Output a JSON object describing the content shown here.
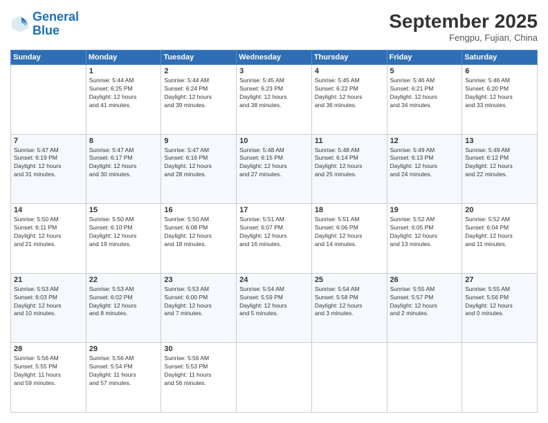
{
  "header": {
    "logo_line1": "General",
    "logo_line2": "Blue",
    "month_title": "September 2025",
    "location": "Fengpu, Fujian, China"
  },
  "weekdays": [
    "Sunday",
    "Monday",
    "Tuesday",
    "Wednesday",
    "Thursday",
    "Friday",
    "Saturday"
  ],
  "weeks": [
    [
      {
        "day": "",
        "info": ""
      },
      {
        "day": "1",
        "info": "Sunrise: 5:44 AM\nSunset: 6:25 PM\nDaylight: 12 hours\nand 41 minutes."
      },
      {
        "day": "2",
        "info": "Sunrise: 5:44 AM\nSunset: 6:24 PM\nDaylight: 12 hours\nand 39 minutes."
      },
      {
        "day": "3",
        "info": "Sunrise: 5:45 AM\nSunset: 6:23 PM\nDaylight: 12 hours\nand 38 minutes."
      },
      {
        "day": "4",
        "info": "Sunrise: 5:45 AM\nSunset: 6:22 PM\nDaylight: 12 hours\nand 36 minutes."
      },
      {
        "day": "5",
        "info": "Sunrise: 5:46 AM\nSunset: 6:21 PM\nDaylight: 12 hours\nand 34 minutes."
      },
      {
        "day": "6",
        "info": "Sunrise: 5:46 AM\nSunset: 6:20 PM\nDaylight: 12 hours\nand 33 minutes."
      }
    ],
    [
      {
        "day": "7",
        "info": "Sunrise: 5:47 AM\nSunset: 6:19 PM\nDaylight: 12 hours\nand 31 minutes."
      },
      {
        "day": "8",
        "info": "Sunrise: 5:47 AM\nSunset: 6:17 PM\nDaylight: 12 hours\nand 30 minutes."
      },
      {
        "day": "9",
        "info": "Sunrise: 5:47 AM\nSunset: 6:16 PM\nDaylight: 12 hours\nand 28 minutes."
      },
      {
        "day": "10",
        "info": "Sunrise: 5:48 AM\nSunset: 6:15 PM\nDaylight: 12 hours\nand 27 minutes."
      },
      {
        "day": "11",
        "info": "Sunrise: 5:48 AM\nSunset: 6:14 PM\nDaylight: 12 hours\nand 25 minutes."
      },
      {
        "day": "12",
        "info": "Sunrise: 5:49 AM\nSunset: 6:13 PM\nDaylight: 12 hours\nand 24 minutes."
      },
      {
        "day": "13",
        "info": "Sunrise: 5:49 AM\nSunset: 6:12 PM\nDaylight: 12 hours\nand 22 minutes."
      }
    ],
    [
      {
        "day": "14",
        "info": "Sunrise: 5:50 AM\nSunset: 6:11 PM\nDaylight: 12 hours\nand 21 minutes."
      },
      {
        "day": "15",
        "info": "Sunrise: 5:50 AM\nSunset: 6:10 PM\nDaylight: 12 hours\nand 19 minutes."
      },
      {
        "day": "16",
        "info": "Sunrise: 5:50 AM\nSunset: 6:08 PM\nDaylight: 12 hours\nand 18 minutes."
      },
      {
        "day": "17",
        "info": "Sunrise: 5:51 AM\nSunset: 6:07 PM\nDaylight: 12 hours\nand 16 minutes."
      },
      {
        "day": "18",
        "info": "Sunrise: 5:51 AM\nSunset: 6:06 PM\nDaylight: 12 hours\nand 14 minutes."
      },
      {
        "day": "19",
        "info": "Sunrise: 5:52 AM\nSunset: 6:05 PM\nDaylight: 12 hours\nand 13 minutes."
      },
      {
        "day": "20",
        "info": "Sunrise: 5:52 AM\nSunset: 6:04 PM\nDaylight: 12 hours\nand 11 minutes."
      }
    ],
    [
      {
        "day": "21",
        "info": "Sunrise: 5:53 AM\nSunset: 6:03 PM\nDaylight: 12 hours\nand 10 minutes."
      },
      {
        "day": "22",
        "info": "Sunrise: 5:53 AM\nSunset: 6:02 PM\nDaylight: 12 hours\nand 8 minutes."
      },
      {
        "day": "23",
        "info": "Sunrise: 5:53 AM\nSunset: 6:00 PM\nDaylight: 12 hours\nand 7 minutes."
      },
      {
        "day": "24",
        "info": "Sunrise: 5:54 AM\nSunset: 5:59 PM\nDaylight: 12 hours\nand 5 minutes."
      },
      {
        "day": "25",
        "info": "Sunrise: 5:54 AM\nSunset: 5:58 PM\nDaylight: 12 hours\nand 3 minutes."
      },
      {
        "day": "26",
        "info": "Sunrise: 5:55 AM\nSunset: 5:57 PM\nDaylight: 12 hours\nand 2 minutes."
      },
      {
        "day": "27",
        "info": "Sunrise: 5:55 AM\nSunset: 5:56 PM\nDaylight: 12 hours\nand 0 minutes."
      }
    ],
    [
      {
        "day": "28",
        "info": "Sunrise: 5:56 AM\nSunset: 5:55 PM\nDaylight: 11 hours\nand 59 minutes."
      },
      {
        "day": "29",
        "info": "Sunrise: 5:56 AM\nSunset: 5:54 PM\nDaylight: 11 hours\nand 57 minutes."
      },
      {
        "day": "30",
        "info": "Sunrise: 5:56 AM\nSunset: 5:53 PM\nDaylight: 11 hours\nand 56 minutes."
      },
      {
        "day": "",
        "info": ""
      },
      {
        "day": "",
        "info": ""
      },
      {
        "day": "",
        "info": ""
      },
      {
        "day": "",
        "info": ""
      }
    ]
  ]
}
